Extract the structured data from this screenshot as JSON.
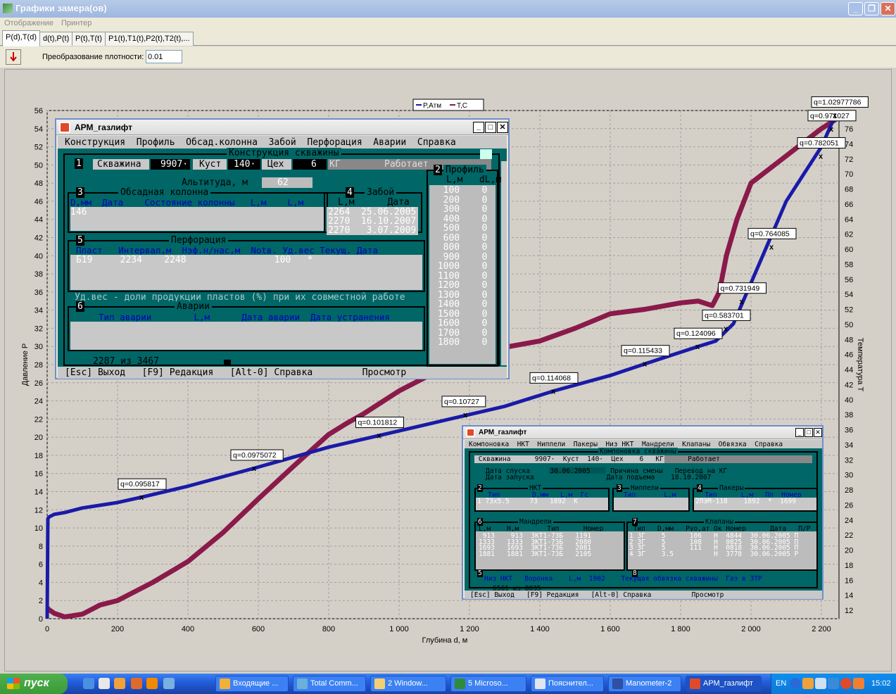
{
  "window": {
    "title": "Графики замера(ов)"
  },
  "menu": [
    "Отображение",
    "Принтер"
  ],
  "tabs": [
    "P(d),T(d)",
    "d(t),P(t)",
    "P(t),T(t)",
    "P1(t),T1(t),P2(t),T2(t),..."
  ],
  "toolbar": {
    "conv_label": "Преобразование плотности:",
    "conv_value": "0.01"
  },
  "chart_data": {
    "type": "line",
    "xlabel": "Глубина d, м",
    "ylabel_left": "Давление Р",
    "ylabel_right": "Температура Т",
    "xlim": [
      0,
      2250
    ],
    "ylim_left": [
      0,
      56
    ],
    "ylim_right": [
      12,
      78
    ],
    "x_ticks": [
      "0",
      "200",
      "400",
      "600",
      "800",
      "1 000",
      "1 200",
      "1 400",
      "1 600",
      "1 800",
      "2 000",
      "2 200"
    ],
    "y_ticks_left": [
      "0",
      "2",
      "4",
      "6",
      "8",
      "10",
      "12",
      "14",
      "16",
      "18",
      "20",
      "22",
      "24",
      "26",
      "28",
      "30",
      "32",
      "34",
      "36",
      "38",
      "40",
      "42",
      "44",
      "46",
      "48",
      "50",
      "52",
      "54",
      "56"
    ],
    "y_ticks_right": [
      "12",
      "14",
      "16",
      "18",
      "20",
      "22",
      "24",
      "26",
      "28",
      "30",
      "32",
      "34",
      "36",
      "38",
      "40",
      "42",
      "44",
      "46",
      "48",
      "50",
      "52",
      "54",
      "56",
      "58",
      "60",
      "62",
      "64",
      "66",
      "68",
      "70",
      "72",
      "74",
      "76"
    ],
    "legend": [
      "P,Атм",
      "T,C"
    ],
    "series": [
      {
        "name": "P,Атм",
        "color": "#1a1aa8",
        "axis": "left",
        "x": [
          0,
          2,
          5,
          10,
          20,
          50,
          100,
          200,
          270,
          400,
          590,
          800,
          945,
          1100,
          1200,
          1300,
          1440,
          1600,
          1700,
          1850,
          1900,
          1950,
          2000,
          2100,
          2200,
          2240
        ],
        "y": [
          0,
          11,
          11.2,
          11.3,
          11.5,
          11.7,
          12.2,
          12.8,
          13.4,
          14.6,
          16.6,
          18.9,
          20.2,
          21.6,
          22.5,
          23.4,
          25.1,
          26.8,
          28.1,
          30,
          30.6,
          32.5,
          37,
          46,
          52,
          55.5
        ]
      },
      {
        "name": "T,C",
        "color": "#8a1a4a",
        "axis": "left",
        "x": [
          0,
          5,
          20,
          50,
          100,
          150,
          200,
          300,
          400,
          500,
          600,
          700,
          800,
          850,
          900,
          1000,
          1100,
          1200,
          1300,
          1400,
          1500,
          1600,
          1700,
          1800,
          1850,
          1890,
          1910,
          1930,
          1960,
          2000,
          2100,
          2200,
          2240
        ],
        "y": [
          1.2,
          1,
          0.6,
          0.2,
          0.5,
          1.5,
          2,
          4,
          6.3,
          9.5,
          13.2,
          16.8,
          20.3,
          21.5,
          22.6,
          25.1,
          27.1,
          28.6,
          29.9,
          30.6,
          32,
          33.6,
          34.1,
          34.8,
          35,
          34.5,
          36,
          40,
          44,
          48,
          51,
          54,
          55
        ]
      }
    ],
    "annotations": [
      {
        "label": "q=0.095817",
        "x": 270,
        "y": 13.4
      },
      {
        "label": "q=0.0975072",
        "x": 590,
        "y": 16.6
      },
      {
        "label": "q=0.101812",
        "x": 945,
        "y": 20.2
      },
      {
        "label": "q=0.10727",
        "x": 1190,
        "y": 22.5
      },
      {
        "label": "q=0.114068",
        "x": 1440,
        "y": 25.1
      },
      {
        "label": "q=0.115433",
        "x": 1700,
        "y": 28.1
      },
      {
        "label": "q=0.124096",
        "x": 1850,
        "y": 30
      },
      {
        "label": "q=0.583701",
        "x": 1930,
        "y": 32
      },
      {
        "label": "q=0.731949",
        "x": 1975,
        "y": 35
      },
      {
        "label": "q=0.764085",
        "x": 2060,
        "y": 41
      },
      {
        "label": "q=0.782051",
        "x": 2200,
        "y": 51
      },
      {
        "label": "q=0.971027",
        "x": 2230,
        "y": 54
      },
      {
        "label": "q=1.02977786",
        "x": 2240,
        "y": 55.5
      }
    ],
    "grid": true
  },
  "dos1": {
    "title": "АРМ_газлифт",
    "menu": "Конструкция  Профиль  Обсад.колонна  Забой  Перфорация  Аварии  Справка",
    "section_title": "Конструкция скважины",
    "well_label": "Скважина",
    "well_value": "9907·",
    "cluster_label": "Куст",
    "cluster_value": "140·",
    "shop_label": "Цех",
    "shop_value": "6",
    "kg": "КГ",
    "status": "Работает",
    "altitude_label": "Альтитуда, м",
    "altitude_value": "62",
    "casing_title": "Обсадная колонна",
    "casing_header": "D,мм  Дата    Состояние колонны   L,м    L,м",
    "casing_row": "146",
    "bottom_title": "Забой",
    "bottom_header": "L,м      Дата",
    "bottom_rows": [
      "2264  25.06.2005",
      "2270  16.10.2007",
      "2270   3.07.2009"
    ],
    "profile_title": "Профиль",
    "profile_header": "L,м   dL,м",
    "profile_rows": [
      "  100    0",
      "  200    0",
      "  300    0",
      "  400    0",
      "  500    0",
      "  600    0",
      "  800    0",
      "  900    0",
      " 1000    0",
      " 1100    0",
      " 1200    0",
      " 1300    0",
      " 1400    0",
      " 1500    0",
      " 1600    0",
      " 1700    0",
      " 1800    0"
    ],
    "perf_title": "Перфорация",
    "perf_header": "Пласт   Интервал,м  Нэф.н/нас,м  Notв. Уд.вес Текущ. Дата",
    "perf_row": "Б19     2234    2248                100   *",
    "note": "Уд.вес - доли продукции пластов (%) при их совместной работе",
    "accident_title": "Аварии",
    "accident_header": "Тип аварии        L,м      Дата аварии  Дата устранения",
    "counter": "2287 из 3467",
    "footer": "[Esc] Выход   [F9] Редакция   [Alt-0] Справка         Просмотр",
    "nums": [
      "1",
      "2",
      "3",
      "4",
      "5",
      "6"
    ]
  },
  "dos2": {
    "title": "АРМ_газлифт",
    "menu": "Компоновка  НКТ  Ниппели  Пакеры  Низ_НКТ  Мандрели  Клапаны  Обвязка  Справка",
    "section_title": "Компоновка скважины",
    "well_line": " Скважина      9907·  Куст  140·  Цех    6   КГ      Работает",
    "l1": "Дата спуска     30.06.2005     Причина смены   Перевод на КГ",
    "l2": "Дата запуска                  Дата подъема    18.10.2007",
    "nkt_title": "НКТ",
    "nkt_header": "   Тип        D,мм   L,м  Гс",
    "nkt_row": "1 73х5.5     73   1892  К",
    "nip_title": "Ниппели",
    "nip_header": "Тип       L,м",
    "pak_title": "Пакеры",
    "pak_header": "  Тип      L,м   Пп  Номер",
    "pak_row": "2ПЭМ-118    1892  *  1699",
    "mand_title": "Мандрели",
    "mand_header": "L,м    Н,м       Тип      Номер",
    "mand_rows": [
      " 913    913  ЗКТ1-73Б   1191",
      "1333   1333  ЗКТ1-73Б   2080",
      "1693   1693  ЗКТ1-73Б   2081",
      "1881   1881  ЗКТ1-73Б   2105"
    ],
    "valve_title": "Клапаны",
    "valve_header": " Тип   D,мм   Руо,ат Ок Номер      Дата   П/Р",
    "valve_rows": [
      "1 3Г    5      106   Н  4844  30.06.2005 П",
      "2 3Г    5      108   Н  0825  30.06.2005 П",
      "3 3Г    5      111   Н  0818  30.06.2005 П",
      "4 3Г    3.5          Н  3778  30.06.2005 Р"
    ],
    "bottom_line": "Низ НКТ   Воронка    L,м  1902    Текущая обвязка скважины  Газ в ЗТР",
    "counter": "6561 из 8035",
    "footer": "[Esc] Выход   [F9] Редакция   [Alt-0] Справка          Просмотр",
    "nums": [
      "1",
      "2",
      "3",
      "4",
      "5",
      "6",
      "7",
      "8"
    ]
  },
  "taskbar": {
    "start": "пуск",
    "tasks": [
      "Входящие ...",
      "Total Comm...",
      "2 Window...",
      "5 Microso...",
      "Пояснител...",
      "Manometer-2",
      "АРМ_газлифт"
    ],
    "lang": "EN",
    "clock": "15:02"
  }
}
